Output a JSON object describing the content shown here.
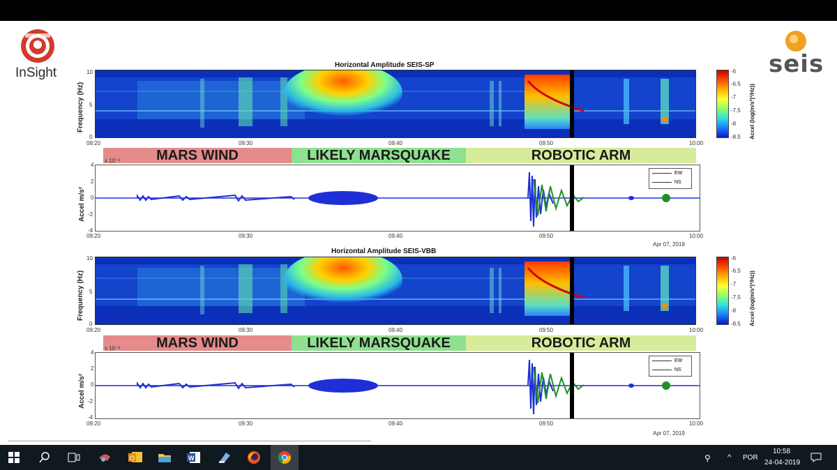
{
  "logos": {
    "insight": "InSight",
    "seis": "seis"
  },
  "colors": {
    "mars_wind": "#e58b8b",
    "marsquake": "#8fe08f",
    "robotic_arm": "#d6ec9a",
    "spec_bg": "#0b2fb8",
    "ew": "#1e2fd6",
    "ns": "#1f8f2a"
  },
  "panels": [
    {
      "title": "Horizontal Amplitude SEIS-SP",
      "spec_ylabel": "Frequency (Hz)",
      "spec_yticks": [
        "10",
        "5",
        "0"
      ],
      "xticks": [
        "09:20",
        "09:30",
        "09:40",
        "09:50",
        "10:00"
      ],
      "colorbar_label": "Accel (log(m/s²)²/Hz))",
      "colorbar_ticks": [
        "-6",
        "-6.5",
        "-7",
        "-7.5",
        "-8",
        "-8.5"
      ],
      "bands": [
        "MARS WIND",
        "LIKELY MARSQUAKE",
        "ROBOTIC ARM"
      ],
      "wave_ylabel": "Accel m/s²",
      "wave_exp": "x 10⁻⁸",
      "wave_yticks": [
        "4",
        "2",
        "0",
        "-2",
        "-4"
      ],
      "legend": [
        "EW",
        "NS"
      ],
      "date": "Apr 07, 2019"
    },
    {
      "title": "Horizontal Amplitude SEIS-VBB",
      "spec_ylabel": "Frequency (Hz)",
      "spec_yticks": [
        "10",
        "5",
        "0"
      ],
      "xticks": [
        "09:20",
        "09:30",
        "09:40",
        "09:50",
        "10:00"
      ],
      "colorbar_label": "Accel (log(m/s²)²/Hz))",
      "colorbar_ticks": [
        "-6",
        "-6.5",
        "-7",
        "-7.5",
        "-8",
        "-8.5"
      ],
      "bands": [
        "MARS WIND",
        "LIKELY MARSQUAKE",
        "ROBOTIC ARM"
      ],
      "wave_ylabel": "Accel m/s²",
      "wave_exp": "x 10⁻⁸",
      "wave_yticks": [
        "4",
        "2",
        "0",
        "-2",
        "-4"
      ],
      "legend": [
        "EW",
        "NS"
      ],
      "date": "Apr 07, 2019"
    }
  ],
  "taskbar": {
    "icons": [
      "windows-start-icon",
      "search-icon",
      "task-view-icon",
      "tool-icon",
      "outlook-icon",
      "file-explorer-icon",
      "word-icon",
      "notepad-icon",
      "firefox-icon",
      "chrome-icon"
    ],
    "lang": "POR",
    "time": "10:58",
    "date": "24-04-2019"
  }
}
